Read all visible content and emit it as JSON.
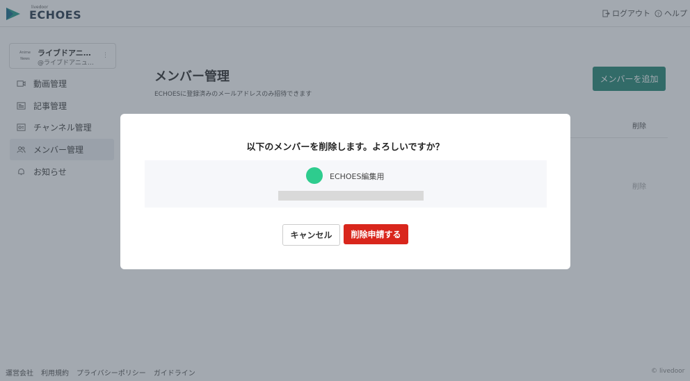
{
  "header": {
    "logo_small": "livedoor",
    "logo_text": "ECHOES",
    "logout_label": "ログアウト",
    "help_label": "ヘルプ"
  },
  "account": {
    "avatar_text": "Anime News",
    "name": "ライブドアニ…",
    "id": "@ライブドアニュ…"
  },
  "sidebar": {
    "items": [
      {
        "label": "動画管理",
        "icon": "video-icon",
        "active": false
      },
      {
        "label": "記事管理",
        "icon": "article-icon",
        "active": false
      },
      {
        "label": "チャンネル管理",
        "icon": "channel-icon",
        "active": false
      },
      {
        "label": "メンバー管理",
        "icon": "members-icon",
        "active": true
      },
      {
        "label": "お知らせ",
        "icon": "bell-icon",
        "active": false
      }
    ]
  },
  "main": {
    "title": "メンバー管理",
    "subtitle": "ECHOESに登録済みのメールアドレスのみ招待できます",
    "add_button": "メンバーを追加",
    "column_delete": "削除",
    "row_delete": "削除"
  },
  "footer": {
    "links": [
      "運営会社",
      "利用規約",
      "プライバシーポリシー",
      "ガイドライン"
    ],
    "brand": "livedoor"
  },
  "modal": {
    "title": "以下のメンバーを削除します。よろしいですか？",
    "member_name": "ECHOES編集用",
    "cancel_label": "キャンセル",
    "confirm_label": "削除申請する"
  },
  "colors": {
    "accent": "#2a8a78",
    "danger": "#d9261c",
    "avatar": "#2ecc8e"
  }
}
